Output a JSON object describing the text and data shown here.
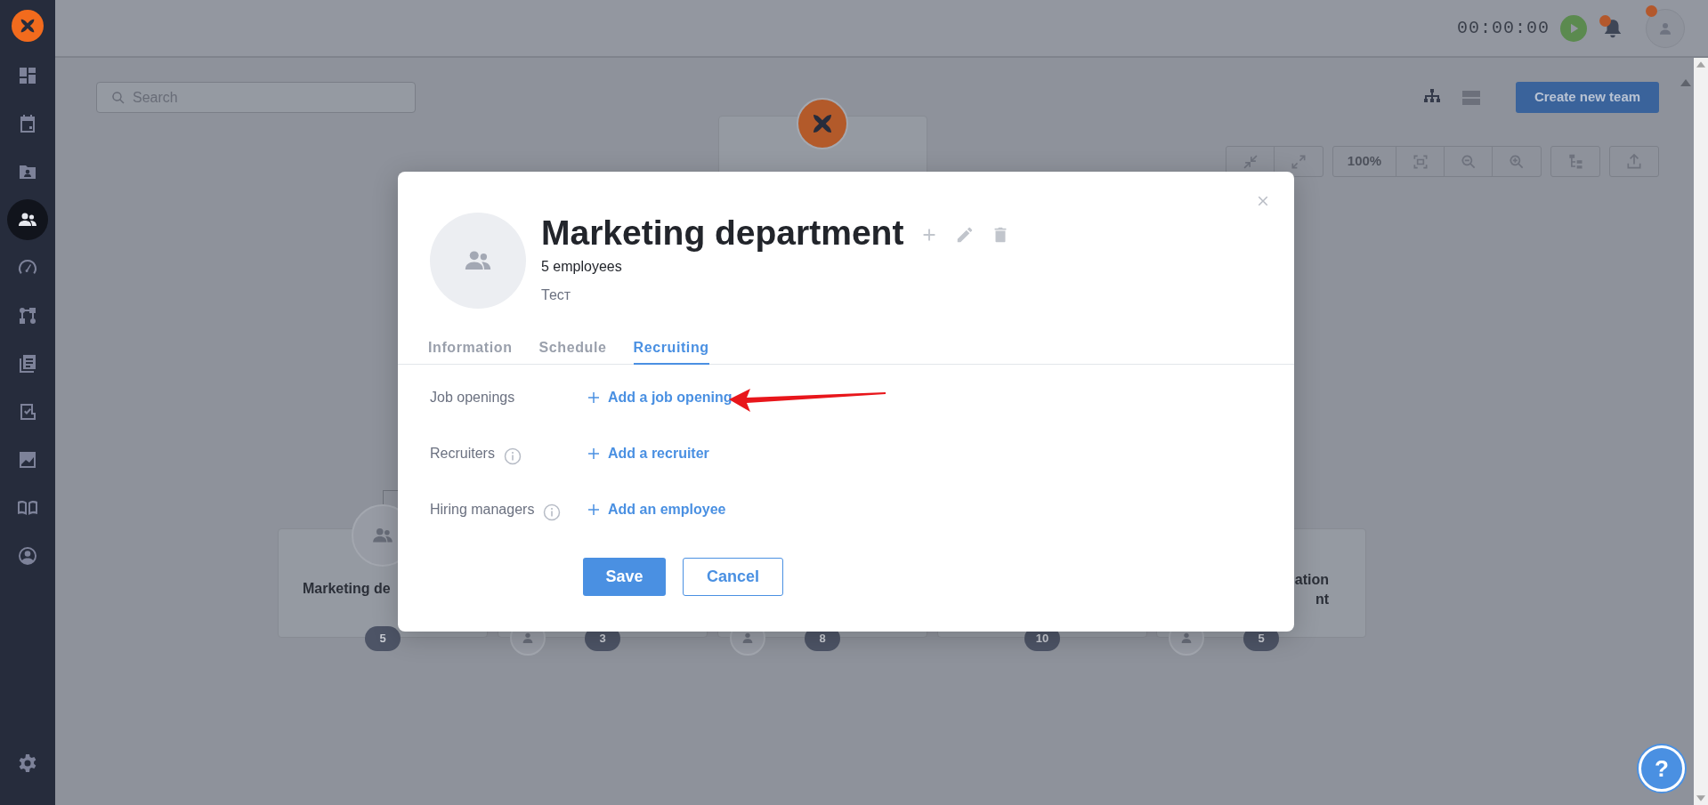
{
  "sidebar": {
    "items": [
      {
        "selected": false
      },
      {
        "selected": false
      },
      {
        "selected": false
      },
      {
        "selected": true
      },
      {
        "selected": false
      },
      {
        "selected": false
      },
      {
        "selected": false
      },
      {
        "selected": false
      },
      {
        "selected": false
      },
      {
        "selected": false
      },
      {
        "selected": false
      }
    ]
  },
  "topbar": {
    "timer": "00:00:00",
    "bell_unread": true,
    "avatar_unread": true
  },
  "search": {
    "placeholder": "Search"
  },
  "view_toggle": [
    {
      "selected": true
    },
    {
      "selected": false
    }
  ],
  "create_button": "Create new team",
  "zoom_toolbar": {
    "zoom": "100%"
  },
  "org_chart": {
    "nodes": [
      {
        "kind": "top-avatar",
        "title_lines": [
          "Marketing de"
        ],
        "badge": "5"
      },
      {
        "kind": "bottom-avatar",
        "badge": "3"
      },
      {
        "kind": "bottom-avatar",
        "badge": "8"
      },
      {
        "kind": "plain",
        "badge": "10"
      },
      {
        "kind": "bottom-avatar",
        "title_lines": [
          "ation",
          "nt"
        ],
        "badge": "5"
      }
    ]
  },
  "modal": {
    "title": "Marketing department",
    "subtitle": "5 employees",
    "description": "Тест",
    "tabs": [
      {
        "label": "Information",
        "selected": false
      },
      {
        "label": "Schedule",
        "selected": false
      },
      {
        "label": "Recruiting",
        "selected": true
      }
    ],
    "rows": [
      {
        "label": "Job openings",
        "info": false,
        "action": "Add a job opening",
        "highlighted": true
      },
      {
        "label": "Recruiters",
        "info": true,
        "action": "Add a recruiter",
        "highlighted": false
      },
      {
        "label": "Hiring managers",
        "info": true,
        "action": "Add an employee",
        "highlighted": false
      }
    ],
    "save": "Save",
    "cancel": "Cancel"
  },
  "help_button": "?"
}
